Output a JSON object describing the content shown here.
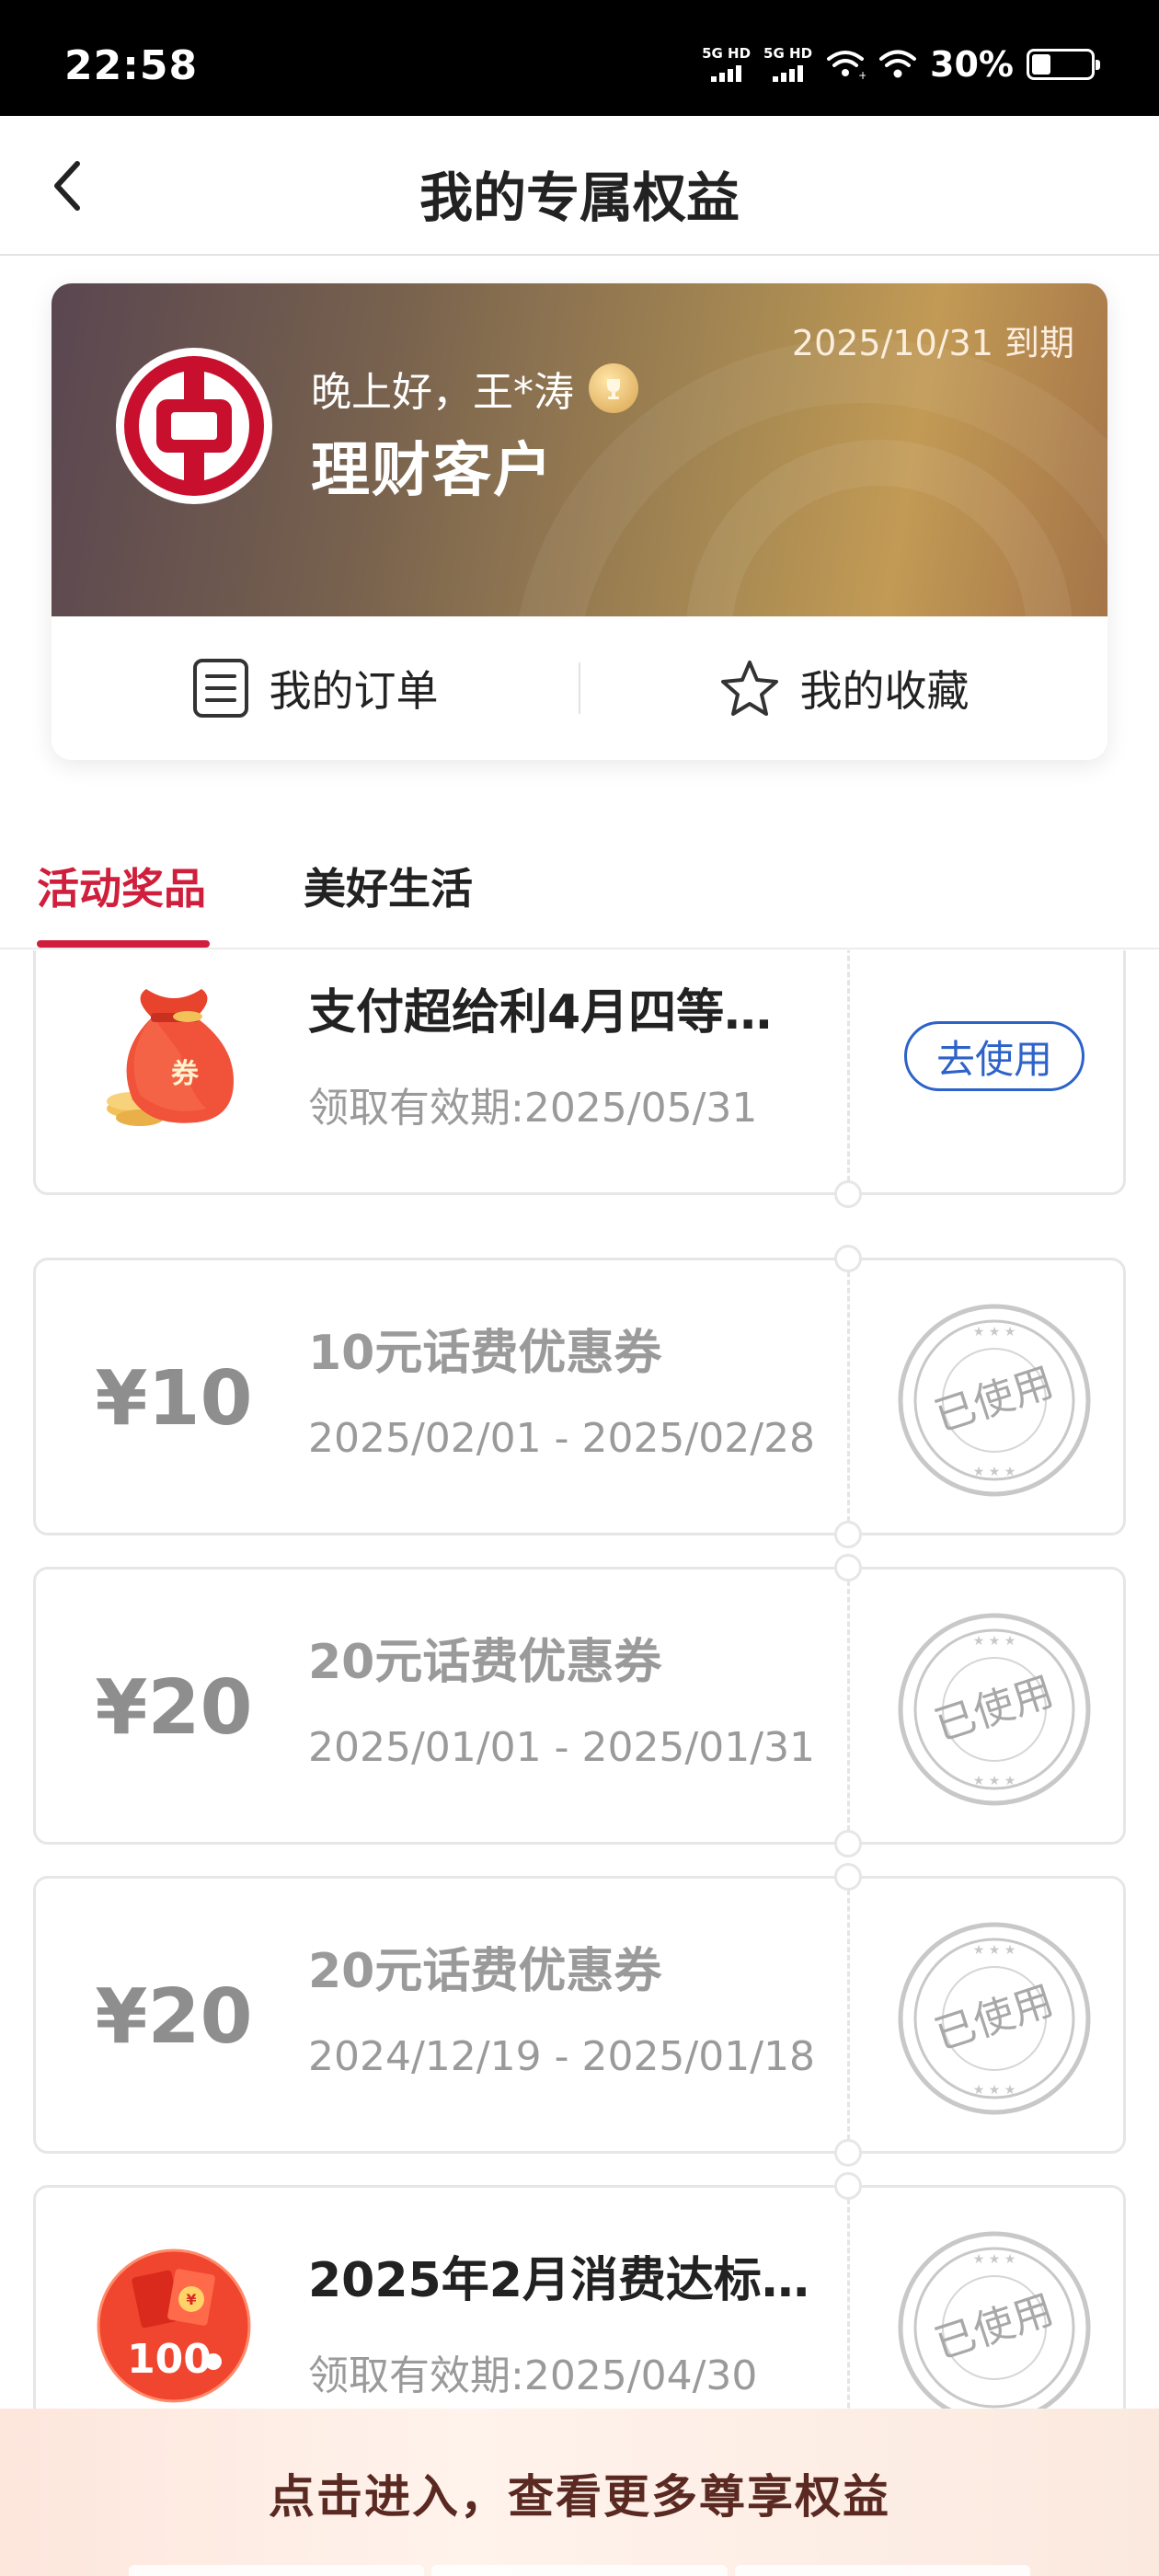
{
  "status_bar": {
    "time": "22:58",
    "network_1": "5G HD",
    "network_2": "5G HD",
    "battery_percent": "30%"
  },
  "nav": {
    "title": "我的专属权益"
  },
  "member_card": {
    "expiry": "2025/10/31 到期",
    "greeting": "晚上好，王*涛",
    "tier": "理财客户",
    "actions": {
      "orders_label": "我的订单",
      "favorites_label": "我的收藏"
    }
  },
  "tabs": [
    {
      "label": "活动奖品",
      "active": true
    },
    {
      "label": "美好生活",
      "active": false
    }
  ],
  "coupons": [
    {
      "title": "支付超给利4月四等…",
      "date": "领取有效期:2025/05/31",
      "status": "active",
      "action_label": "去使用",
      "icon": "red-coupon-bag-icon",
      "bag_label": "券"
    },
    {
      "amount": "¥10",
      "title": "10元话费优惠券",
      "date": "2025/02/01 - 2025/02/28",
      "status": "used",
      "stamp_label": "已使用"
    },
    {
      "amount": "¥20",
      "title": "20元话费优惠券",
      "date": "2025/01/01 - 2025/01/31",
      "status": "used",
      "stamp_label": "已使用"
    },
    {
      "amount": "¥20",
      "title": "20元话费优惠券",
      "date": "2024/12/19 - 2025/01/18",
      "status": "used",
      "stamp_label": "已使用"
    },
    {
      "title": "2025年2月消费达标…",
      "date": "领取有效期:2025/04/30",
      "status": "used",
      "stamp_label": "已使用",
      "icon": "red-envelope-100-icon",
      "badge_value": "100"
    }
  ],
  "bottom_banner": {
    "text": "点击进入，查看更多尊享权益"
  },
  "colors": {
    "accent_red": "#d01f3c",
    "link_blue": "#2d63c8",
    "muted_gray": "#9a9a9a"
  }
}
